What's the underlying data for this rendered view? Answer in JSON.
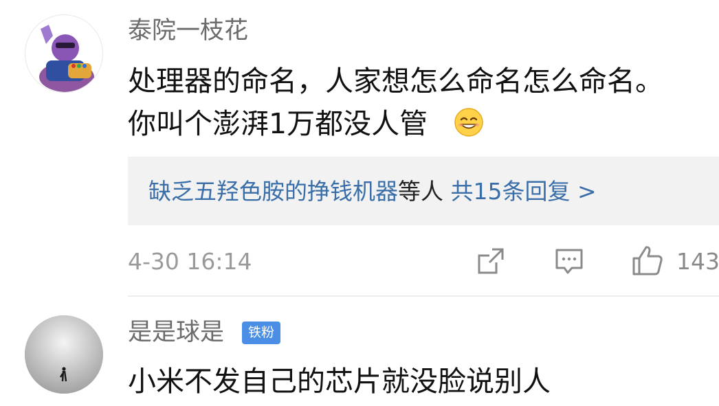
{
  "comments": [
    {
      "username": "泰院一枝花",
      "lines": [
        "处理器的命名，人家想怎么命名怎么命名。",
        "你叫个澎湃1万都没人管"
      ],
      "emoji": "grin-emoji",
      "reply_summary": {
        "names": "缺乏五羟色胺的挣钱机器",
        "connector": "等人",
        "count_text": "共15条回复",
        "chevron": ">"
      },
      "timestamp": "4-30 16:14",
      "likes": "143"
    },
    {
      "username": "是是球是",
      "badge": "铁粉",
      "lines": [
        "小米不发自己的芯片就没脸说别人"
      ]
    }
  ],
  "colors": {
    "link": "#3a6ea8",
    "badge": "#4a8ee6",
    "reply_bg": "#f2f2f2"
  }
}
